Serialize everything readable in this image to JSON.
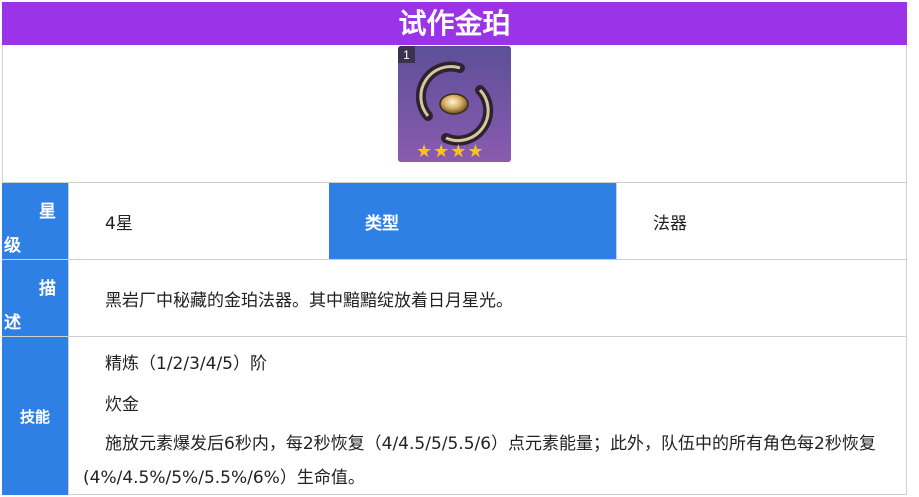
{
  "title": "试作金珀",
  "item": {
    "icon": "golden-ring-catalyst-icon",
    "refinement_badge": "1",
    "stars": 4,
    "colors": {
      "title_bg": "#9b34e8",
      "label_bg": "#2f80e5",
      "star": "#f5c419"
    }
  },
  "rows": {
    "rarity": {
      "label_1": "星",
      "label_2": "级",
      "value": "4星"
    },
    "type": {
      "label": "类型",
      "value": "法器"
    },
    "description": {
      "label_1": "描",
      "label_2": "述",
      "value": "黑岩厂中秘藏的金珀法器。其中黯黯绽放着日月星光。"
    },
    "skill": {
      "label": "技能",
      "line1": "精炼（1/2/3/4/5）阶",
      "line2": "炊金",
      "line3": "施放元素爆发后6秒内，每2秒恢复（4/4.5/5/5.5/6）点元素能量；此外，队伍中的所有角色每2秒恢复",
      "line4": "(4%/4.5%/5%/5.5%/6%）生命值。"
    }
  }
}
